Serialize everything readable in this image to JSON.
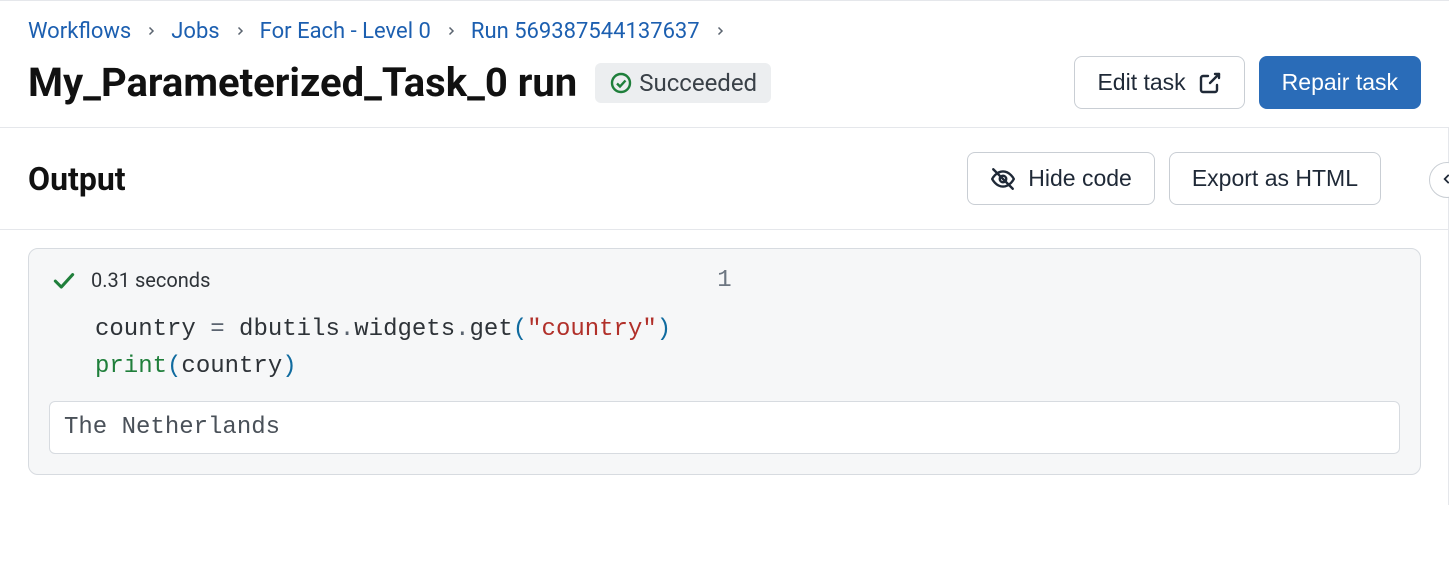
{
  "breadcrumb": {
    "items": [
      {
        "label": "Workflows"
      },
      {
        "label": "Jobs"
      },
      {
        "label": "For Each - Level 0"
      },
      {
        "label": "Run 569387544137637"
      }
    ]
  },
  "header": {
    "title": "My_Parameterized_Task_0 run",
    "status": "Succeeded",
    "edit_task_label": "Edit task",
    "repair_task_label": "Repair task"
  },
  "output": {
    "title": "Output",
    "hide_code_label": "Hide code",
    "export_html_label": "Export as HTML"
  },
  "cell": {
    "duration": "0.31 seconds",
    "counter": "1",
    "code": {
      "line1_var": "country",
      "line1_eq": " = ",
      "line1_obj": "dbutils",
      "line1_dot1": ".",
      "line1_attr1": "widgets",
      "line1_dot2": ".",
      "line1_call": "get",
      "line1_lp": "(",
      "line1_str": "\"country\"",
      "line1_rp": ")",
      "line2_fn": "print",
      "line2_lp": "(",
      "line2_arg": "country",
      "line2_rp": ")"
    },
    "result": "The Netherlands"
  }
}
